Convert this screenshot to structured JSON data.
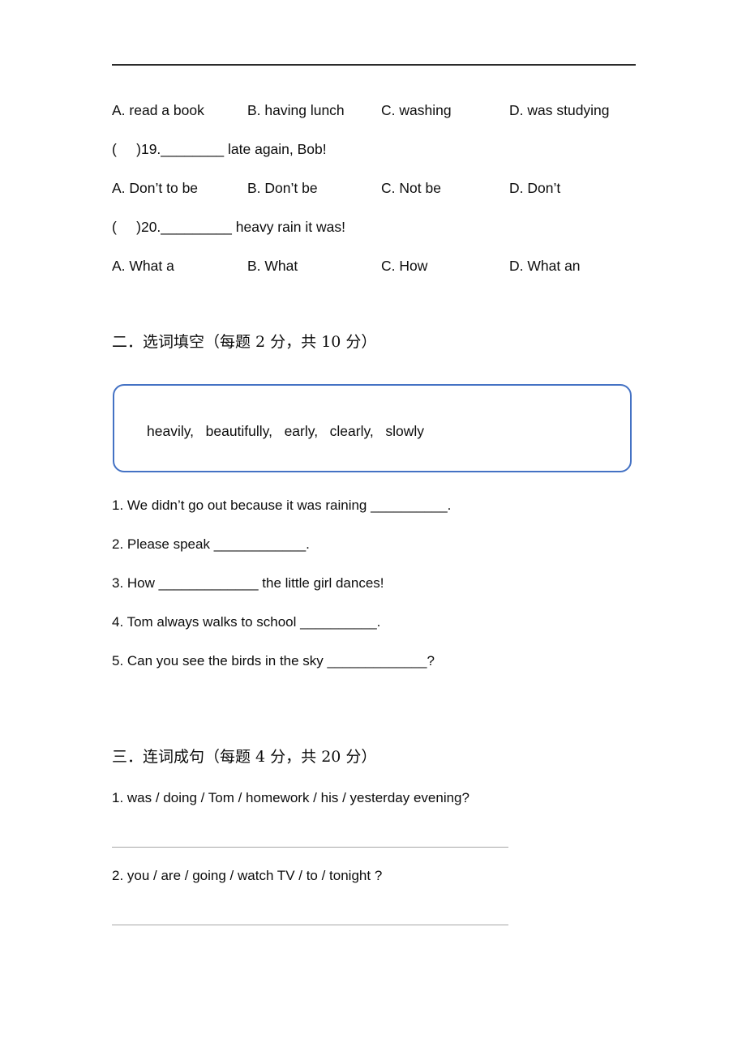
{
  "document": {
    "type": "english-exam-worksheet",
    "page_background": "#ffffff",
    "text_color": "#0d0d0d",
    "rule_color": "#2b2b2b",
    "accent_color": "#4472c4",
    "answer_line_color": "#a6a6a6"
  },
  "section_one_tail": {
    "q18_options": [
      "A. read a book",
      "B. having lunch",
      "C. washing",
      "D. was studying"
    ],
    "q19_stem": "(     )19.________ late again, Bob!",
    "q19_options": [
      "A. Don’t to be",
      "B. Don’t be",
      "C. Not be",
      "D. Don’t"
    ],
    "q20_stem": "(     )20._________ heavy rain it was!",
    "q20_options": [
      "A. What a",
      "B. What",
      "C. How",
      "D. What an"
    ]
  },
  "section_two": {
    "heading": "二．选词填空（每题 2 分，共 10 分）",
    "word_bank": "heavily,   beautifully,   early,   clearly,   slowly",
    "items": [
      "1. We didn’t go out because it was raining __________.",
      "2. Please speak ____________.",
      "3. How _____________ the little girl dances!",
      "4. Tom always walks to school __________.",
      "5. Can you see the birds in the sky _____________?"
    ]
  },
  "section_three": {
    "heading": "三．连词成句（每题 4 分，共 20 分）",
    "items": [
      "1. was / doing / Tom / homework / his / yesterday evening?",
      "2. you / are / going / watch TV / to / tonight ?"
    ]
  }
}
